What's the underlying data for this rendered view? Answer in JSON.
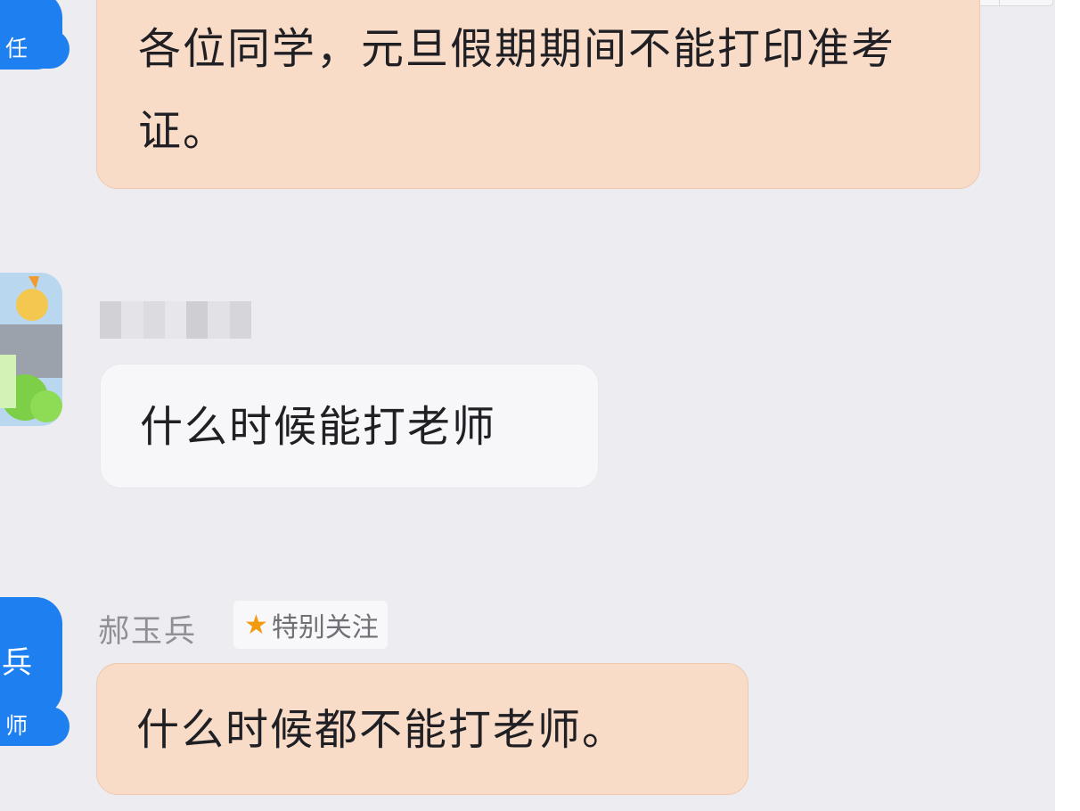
{
  "messages": [
    {
      "role_label": "任",
      "text": "各位同学，元旦假期期间不能打印准考证。"
    },
    {
      "text": "什么时候能打老师"
    },
    {
      "sender": "郝玉兵",
      "tag_label": "特别关注",
      "role_label_top": "兵",
      "role_label_bottom": "师",
      "text": "什么时候都不能打老师。"
    }
  ],
  "colors": {
    "background": "#edecf0",
    "teacher_bubble": "#f8dcc8",
    "student_bubble": "#f7f7fa",
    "role_pill": "#1e7ff0",
    "tag_star": "#f29b11"
  },
  "icons": {
    "special_follow": "star-icon"
  }
}
